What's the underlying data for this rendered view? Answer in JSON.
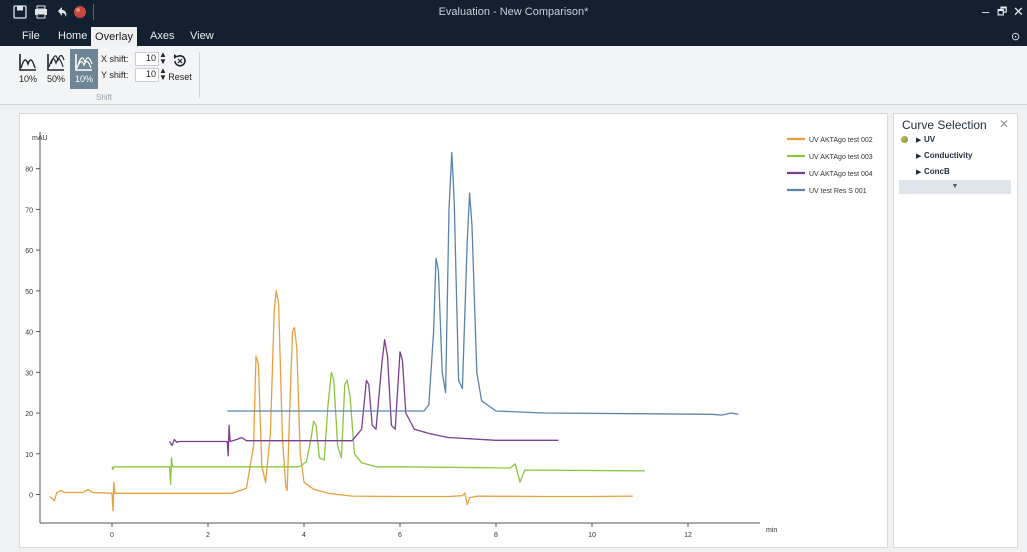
{
  "window": {
    "title": "Evaluation - New Comparison*"
  },
  "quick_access": [
    "save-icon",
    "print-icon",
    "undo-icon",
    "record-icon"
  ],
  "menu": {
    "tabs": [
      {
        "label": "File",
        "active": false
      },
      {
        "label": "Home",
        "active": false
      },
      {
        "label": "Overlay",
        "active": true
      },
      {
        "label": "Axes",
        "active": false
      },
      {
        "label": "View",
        "active": false
      }
    ]
  },
  "ribbon": {
    "buttons": [
      {
        "label": "10%",
        "icon": "overlay-10-icon",
        "active": false
      },
      {
        "label": "50%",
        "icon": "overlay-50-icon",
        "active": false
      },
      {
        "label": "10%",
        "icon": "stacked-10-icon",
        "active": true
      }
    ],
    "x_shift_label": "X shift:",
    "x_shift_value": "10",
    "y_shift_label": "Y shift:",
    "y_shift_value": "10",
    "reset_label": "Reset",
    "group_label": "Shift"
  },
  "curve_selection": {
    "title": "Curve Selection",
    "items": [
      {
        "label": "UV",
        "selected": true
      },
      {
        "label": "Conductivity",
        "selected": false
      },
      {
        "label": "ConcB",
        "selected": false
      }
    ]
  },
  "chart_data": {
    "type": "line",
    "ylabel": "mAU",
    "xlabel": "min",
    "xlim": [
      -1.5,
      13.5
    ],
    "ylim": [
      -7,
      89
    ],
    "x_ticks": [
      0,
      2,
      4,
      6,
      8,
      10,
      12
    ],
    "y_ticks": [
      0,
      10,
      20,
      30,
      40,
      50,
      60,
      70,
      80
    ],
    "legend_position": "top-right",
    "series": [
      {
        "name": "UV AKTAgo test 002",
        "color": "#e8a040",
        "points": [
          [
            -1.3,
            -0.5
          ],
          [
            -1.2,
            -1.5
          ],
          [
            -1.15,
            0.5
          ],
          [
            -1.05,
            1.0
          ],
          [
            -1,
            0.5
          ],
          [
            -0.6,
            0.5
          ],
          [
            -0.5,
            1.2
          ],
          [
            -0.4,
            0.5
          ],
          [
            0,
            0.3
          ],
          [
            0.02,
            -4
          ],
          [
            0.04,
            3
          ],
          [
            0.06,
            0.3
          ],
          [
            2,
            0.3
          ],
          [
            2.5,
            0.3
          ],
          [
            2.8,
            1.5
          ],
          [
            2.95,
            12
          ],
          [
            3.0,
            34
          ],
          [
            3.05,
            32
          ],
          [
            3.12,
            7
          ],
          [
            3.2,
            3
          ],
          [
            3.3,
            15
          ],
          [
            3.38,
            45
          ],
          [
            3.42,
            50
          ],
          [
            3.47,
            47
          ],
          [
            3.55,
            14
          ],
          [
            3.62,
            2
          ],
          [
            3.65,
            1
          ],
          [
            3.7,
            20
          ],
          [
            3.76,
            40
          ],
          [
            3.8,
            41
          ],
          [
            3.85,
            36
          ],
          [
            3.92,
            10
          ],
          [
            4.0,
            3
          ],
          [
            4.2,
            1.3
          ],
          [
            4.5,
            0.3
          ],
          [
            5.0,
            -0.4
          ],
          [
            6,
            -0.5
          ],
          [
            7,
            -0.5
          ],
          [
            7.3,
            -0.3
          ],
          [
            7.35,
            0.4
          ],
          [
            7.4,
            -2.5
          ],
          [
            7.45,
            -0.8
          ],
          [
            7.6,
            -0.4
          ],
          [
            9,
            -0.5
          ],
          [
            10,
            -0.5
          ],
          [
            10.85,
            -0.4
          ]
        ]
      },
      {
        "name": "UV AKTAgo test 003",
        "color": "#8cc63f",
        "points": [
          [
            0,
            6.8
          ],
          [
            0.02,
            6.1
          ],
          [
            0.04,
            6.8
          ],
          [
            1.2,
            6.8
          ],
          [
            1.22,
            2.5
          ],
          [
            1.24,
            9
          ],
          [
            1.26,
            6.8
          ],
          [
            3.9,
            6.8
          ],
          [
            4.05,
            8
          ],
          [
            4.15,
            14
          ],
          [
            4.2,
            18
          ],
          [
            4.25,
            17
          ],
          [
            4.32,
            9
          ],
          [
            4.42,
            8.5
          ],
          [
            4.5,
            22
          ],
          [
            4.57,
            30
          ],
          [
            4.62,
            28
          ],
          [
            4.7,
            12
          ],
          [
            4.78,
            9
          ],
          [
            4.85,
            27
          ],
          [
            4.9,
            28
          ],
          [
            4.96,
            24
          ],
          [
            5.05,
            10
          ],
          [
            5.2,
            7.8
          ],
          [
            5.5,
            6.8
          ],
          [
            6,
            6.8
          ],
          [
            8.3,
            6.5
          ],
          [
            8.4,
            7.5
          ],
          [
            8.5,
            3
          ],
          [
            8.6,
            6
          ],
          [
            8.8,
            6
          ],
          [
            11.1,
            5.8
          ]
        ]
      },
      {
        "name": "UV AKTAgo test 004",
        "color": "#7b3f8f",
        "points": [
          [
            1.2,
            13
          ],
          [
            1.25,
            12
          ],
          [
            1.3,
            13.5
          ],
          [
            1.35,
            12.8
          ],
          [
            1.4,
            13
          ],
          [
            2.4,
            13
          ],
          [
            2.42,
            9.5
          ],
          [
            2.44,
            17
          ],
          [
            2.46,
            13
          ],
          [
            2.6,
            13.5
          ],
          [
            2.7,
            14
          ],
          [
            2.8,
            13.2
          ],
          [
            5.0,
            13.2
          ],
          [
            5.2,
            16
          ],
          [
            5.3,
            28
          ],
          [
            5.35,
            27
          ],
          [
            5.42,
            17
          ],
          [
            5.5,
            16
          ],
          [
            5.62,
            32
          ],
          [
            5.68,
            38
          ],
          [
            5.74,
            34
          ],
          [
            5.82,
            17
          ],
          [
            5.9,
            16
          ],
          [
            6.0,
            35
          ],
          [
            6.05,
            33
          ],
          [
            6.12,
            20
          ],
          [
            6.3,
            16
          ],
          [
            6.6,
            15
          ],
          [
            7,
            14
          ],
          [
            8,
            13.3
          ],
          [
            9.3,
            13.3
          ]
        ]
      },
      {
        "name": "UV test Res S 001",
        "color": "#5b84ab",
        "points": [
          [
            2.4,
            20.5
          ],
          [
            6.5,
            20.5
          ],
          [
            6.6,
            22
          ],
          [
            6.7,
            40
          ],
          [
            6.75,
            58
          ],
          [
            6.8,
            55
          ],
          [
            6.88,
            30
          ],
          [
            6.95,
            25
          ],
          [
            7.02,
            70
          ],
          [
            7.08,
            84
          ],
          [
            7.13,
            72
          ],
          [
            7.22,
            28
          ],
          [
            7.3,
            26
          ],
          [
            7.4,
            62
          ],
          [
            7.45,
            74
          ],
          [
            7.5,
            66
          ],
          [
            7.6,
            30
          ],
          [
            7.7,
            23
          ],
          [
            8,
            20.5
          ],
          [
            9,
            20
          ],
          [
            12.5,
            19.7
          ],
          [
            12.7,
            19.5
          ],
          [
            12.9,
            20
          ],
          [
            13.05,
            19.7
          ]
        ]
      }
    ]
  }
}
